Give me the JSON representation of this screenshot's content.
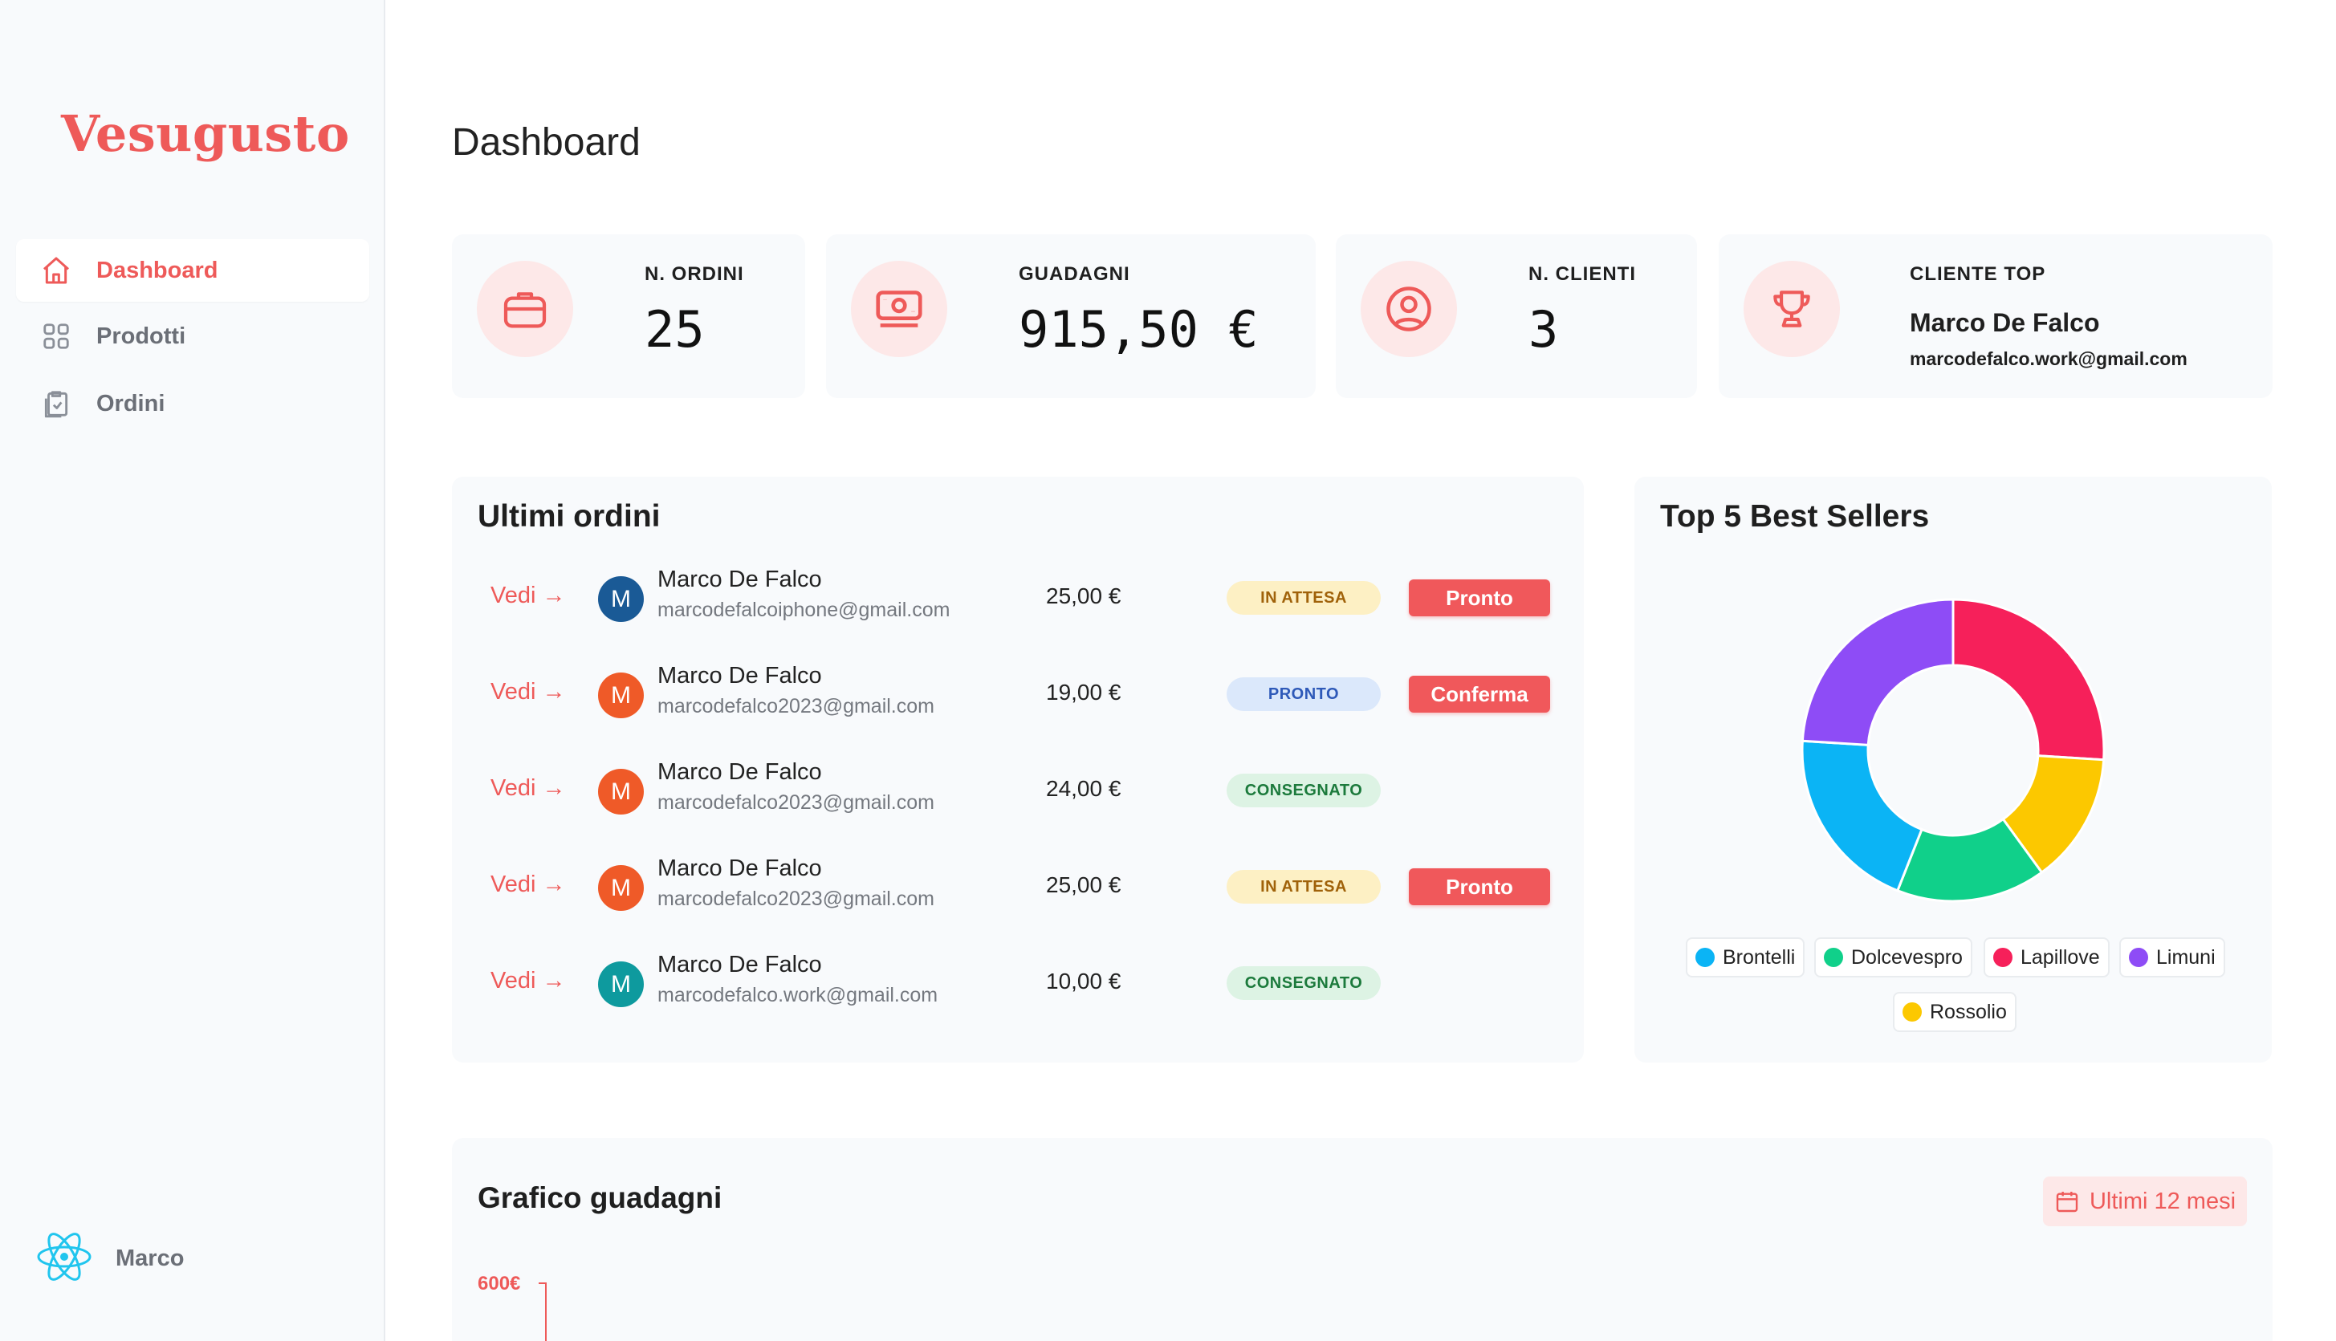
{
  "app": {
    "brand": "Vesugusto"
  },
  "sidebar": {
    "items": [
      {
        "label": "Dashboard",
        "icon": "home-icon",
        "active": true
      },
      {
        "label": "Prodotti",
        "icon": "grid-icon",
        "active": false
      },
      {
        "label": "Ordini",
        "icon": "clipboard-check-icon",
        "active": false
      }
    ],
    "user": {
      "name": "Marco",
      "icon": "react-atom-icon"
    }
  },
  "page": {
    "title": "Dashboard"
  },
  "stats": {
    "orders": {
      "label": "N. ORDINI",
      "value": "25",
      "icon": "briefcase-icon"
    },
    "earnings": {
      "label": "GUADAGNI",
      "value": "915,50 €",
      "icon": "banknote-icon"
    },
    "clients": {
      "label": "N. CLIENTI",
      "value": "3",
      "icon": "user-circle-icon"
    },
    "top_client": {
      "label": "CLIENTE TOP",
      "name": "Marco De Falco",
      "email": "marcodefalco.work@gmail.com",
      "icon": "trophy-icon"
    }
  },
  "orders": {
    "title": "Ultimi ordini",
    "link_label": "Vedi →",
    "rows": [
      {
        "avatar": "M",
        "avatar_color": "#1a5a96",
        "name": "Marco De Falco",
        "email": "marcodefalcoiphone@gmail.com",
        "amount": "25,00 €",
        "status": "IN ATTESA",
        "status_kind": "wait",
        "action": "Pronto"
      },
      {
        "avatar": "M",
        "avatar_color": "#ef5a28",
        "name": "Marco De Falco",
        "email": "marcodefalco2023@gmail.com",
        "amount": "19,00 €",
        "status": "PRONTO",
        "status_kind": "ready",
        "action": "Conferma"
      },
      {
        "avatar": "M",
        "avatar_color": "#ef5a28",
        "name": "Marco De Falco",
        "email": "marcodefalco2023@gmail.com",
        "amount": "24,00 €",
        "status": "CONSEGNATO",
        "status_kind": "done",
        "action": ""
      },
      {
        "avatar": "M",
        "avatar_color": "#ef5a28",
        "name": "Marco De Falco",
        "email": "marcodefalco2023@gmail.com",
        "amount": "25,00 €",
        "status": "IN ATTESA",
        "status_kind": "wait",
        "action": "Pronto"
      },
      {
        "avatar": "M",
        "avatar_color": "#0e9a9e",
        "name": "Marco De Falco",
        "email": "marcodefalco.work@gmail.com",
        "amount": "10,00 €",
        "status": "CONSEGNATO",
        "status_kind": "done",
        "action": ""
      }
    ]
  },
  "best_sellers": {
    "title": "Top 5 Best Sellers",
    "legend": [
      {
        "name": "Brontelli",
        "color": "#0bb4f5"
      },
      {
        "name": "Dolcevespro",
        "color": "#10d08a"
      },
      {
        "name": "Lapillove",
        "color": "#f6205a"
      },
      {
        "name": "Limuni",
        "color": "#8e4cf6"
      },
      {
        "name": "Rossolio",
        "color": "#fcc800"
      }
    ]
  },
  "chart_data": {
    "type": "pie",
    "title": "Top 5 Best Sellers",
    "donut": true,
    "categories": [
      "Lapillove",
      "Rossolio",
      "Dolcevespro",
      "Brontelli",
      "Limuni"
    ],
    "values": [
      26,
      14,
      16,
      20,
      24
    ],
    "colors": [
      "#f6205a",
      "#fcc800",
      "#10d08a",
      "#0bb4f5",
      "#8e4cf6"
    ],
    "legend": "bottom"
  },
  "earnings_chart": {
    "title": "Grafico guadagni",
    "range_label": "Ultimi 12 mesi",
    "range_icon": "calendar-icon",
    "y_top_tick": "600€"
  }
}
